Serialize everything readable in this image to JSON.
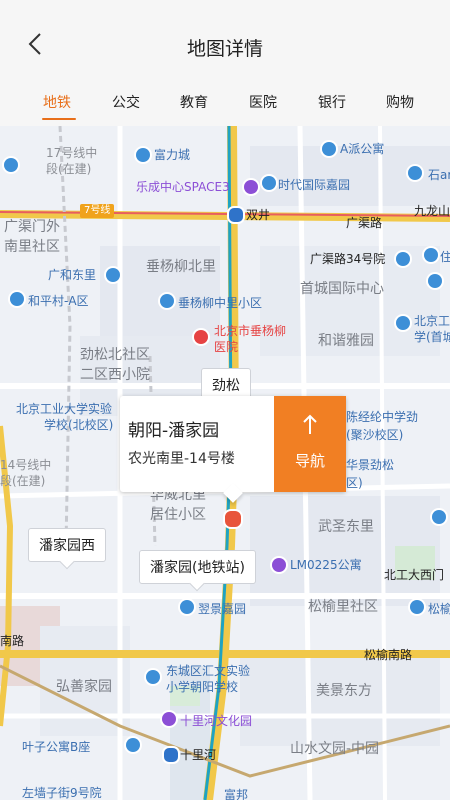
{
  "header": {
    "title": "地图详情"
  },
  "tabs": [
    {
      "label": "地铁"
    },
    {
      "label": "公交"
    },
    {
      "label": "教育"
    },
    {
      "label": "医院"
    },
    {
      "label": "银行"
    },
    {
      "label": "购物"
    }
  ],
  "map": {
    "roads": {
      "line17_a": "17号线中",
      "line17_b": "段(在建)",
      "line7": "7号线",
      "guangqu": "广渠路",
      "line14_a": "14号线中",
      "line14_b": "段(在建)",
      "songyu": "松榆南路"
    },
    "pois": {
      "fuli": "富力城",
      "apai": "A派公寓",
      "lecheng": "乐成中心SPACE3",
      "shidai": "时代国际嘉园",
      "shiyou": "石artist",
      "shuangjing": "双井",
      "jiulong": "九龙山",
      "guangqumen_a": "广渠门外",
      "guangqumen_b": "南里社区",
      "chuiyang": "垂杨柳北里",
      "guangqu34": "广渠路34号院",
      "zhu": "住",
      "guanghe": "广和东里",
      "hepingcun": "和平村-A区",
      "chuiyang_mid": "垂杨柳中里小区",
      "shoucheng": "首城国际中心",
      "beigongye_r_a": "北京工",
      "beigongye_r_b": "学(首城",
      "hospital_a": "北京市垂杨柳",
      "hospital_b": "医院",
      "jinsong_north_a": "劲松北社区",
      "jinsong_north_b": "二区西小院",
      "hexie": "和谐雅园",
      "school_a": "北京工业大学实验",
      "school_b": "学校(北校区)",
      "chenjing_a": "陈经纶中学劲",
      "chenjing_b": "(聚沙校区)",
      "huajing_a": "华景劲松",
      "huajing_b": "区)",
      "huawei_a": "华威北里",
      "huawei_b": "居住小区",
      "wusheng": "武圣东里",
      "lm0225": "LM0225公寓",
      "beigong_gate": "北工大西门",
      "yujing": "翌景嘉园",
      "songyuli": "松榆里社区",
      "songyu_r": "松榆",
      "nanlu": "南路",
      "hongshan": "弘善家园",
      "dongcheng_a": "东城区汇文实验",
      "dongcheng_b": "小学朝阳学校",
      "meijing": "美景东方",
      "shilihe_park": "十里河文化园",
      "yezi": "叶子公寓B座",
      "shilihe": "十里河",
      "shanshui": "山水文园-中园",
      "bottom_left": "左墙子街9号院",
      "bottom_mid": "富邦"
    },
    "callouts": {
      "jinsong": "劲松",
      "panjiayuan_west": "潘家园西",
      "panjiayuan": "潘家园(地铁站)"
    }
  },
  "info_card": {
    "name": "朝阳-潘家园",
    "address": "农光南里-14号楼",
    "nav_label": "导航"
  },
  "colors": {
    "accent": "#e86f1a",
    "nav_button": "#f17f23",
    "line10": "#1fa3c2",
    "line14": "#c6a86f",
    "road": "#f1c84a"
  }
}
